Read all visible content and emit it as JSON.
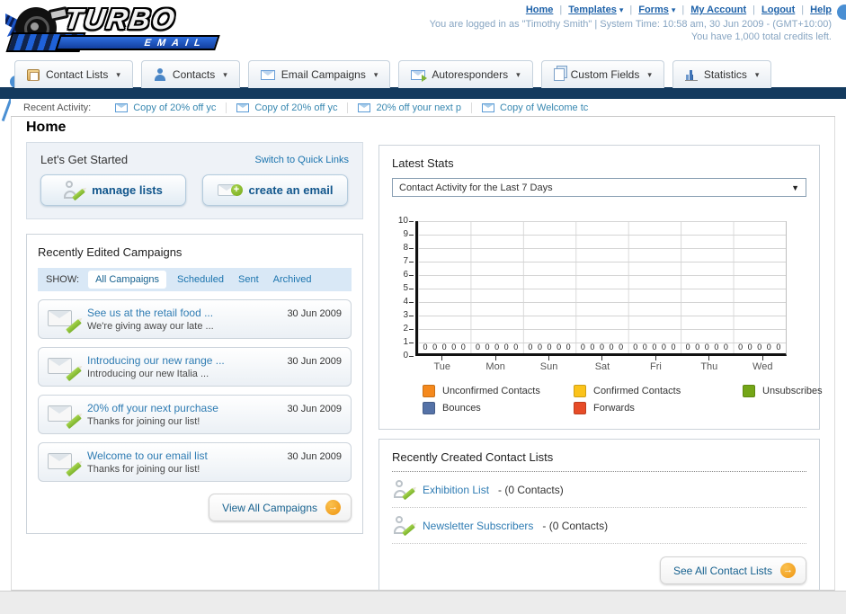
{
  "header": {
    "logo_line1": "TURBO",
    "logo_line2": "EMAIL",
    "nav_links": [
      {
        "label": "Home",
        "dropdown": false
      },
      {
        "label": "Templates",
        "dropdown": true
      },
      {
        "label": "Forms",
        "dropdown": true
      },
      {
        "label": "My Account",
        "dropdown": false
      },
      {
        "label": "Logout",
        "dropdown": false
      },
      {
        "label": "Help",
        "dropdown": false
      }
    ],
    "login_info": "You are logged in as \"Timothy Smith\" | System Time: 10:58 am, 30 Jun 2009 - (GMT+10:00)",
    "credits_info": "You have 1,000 total credits left."
  },
  "main_nav": {
    "tabs": [
      {
        "label": "Contact Lists",
        "icon": "address-book-icon"
      },
      {
        "label": "Contacts",
        "icon": "person-icon"
      },
      {
        "label": "Email Campaigns",
        "icon": "envelope-icon"
      },
      {
        "label": "Autoresponders",
        "icon": "envelope-arrow-icon"
      },
      {
        "label": "Custom Fields",
        "icon": "pages-icon"
      },
      {
        "label": "Statistics",
        "icon": "bar-chart-icon"
      }
    ]
  },
  "recent_activity": {
    "label": "Recent Activity:",
    "items": [
      "Copy of 20% off yc",
      "Copy of 20% off yc",
      "20% off your next p",
      "Copy of Welcome tc"
    ]
  },
  "page_title": "Home",
  "get_started": {
    "title": "Let's Get Started",
    "switch_link": "Switch to Quick Links",
    "buttons": [
      {
        "label": "manage lists",
        "icon": "person-edit-icon"
      },
      {
        "label": "create an email",
        "icon": "envelope-plus-icon"
      }
    ]
  },
  "campaigns": {
    "title": "Recently Edited Campaigns",
    "show_label": "SHOW:",
    "tabs": [
      "All Campaigns",
      "Scheduled",
      "Sent",
      "Archived"
    ],
    "active_tab": "All Campaigns",
    "items": [
      {
        "title": "See us at the retail food ...",
        "subtitle": "We're giving away our late ...",
        "date": "30 Jun 2009"
      },
      {
        "title": "Introducing our new range ...",
        "subtitle": "Introducing our new Italia ...",
        "date": "30 Jun 2009"
      },
      {
        "title": "20% off your next purchase",
        "subtitle": "Thanks for joining our list!",
        "date": "30 Jun 2009"
      },
      {
        "title": "Welcome to our email list",
        "subtitle": "Thanks for joining our list!",
        "date": "30 Jun 2009"
      }
    ],
    "view_all_label": "View All Campaigns",
    "arrow_glyph": "→"
  },
  "latest_stats": {
    "title": "Latest Stats",
    "dropdown_value": "Contact Activity for the Last 7 Days"
  },
  "chart_data": {
    "type": "bar",
    "title": "Contact Activity for the Last 7 Days",
    "categories": [
      "Tue",
      "Mon",
      "Sun",
      "Sat",
      "Fri",
      "Thu",
      "Wed"
    ],
    "series": [
      {
        "name": "Unconfirmed Contacts",
        "color": "#F5891D",
        "values": [
          0,
          0,
          0,
          0,
          0,
          0,
          0
        ]
      },
      {
        "name": "Confirmed Contacts",
        "color": "#FBC31B",
        "values": [
          0,
          0,
          0,
          0,
          0,
          0,
          0
        ]
      },
      {
        "name": "Unsubscribes",
        "color": "#74A617",
        "values": [
          0,
          0,
          0,
          0,
          0,
          0,
          0
        ]
      },
      {
        "name": "Bounces",
        "color": "#5572A7",
        "values": [
          0,
          0,
          0,
          0,
          0,
          0,
          0
        ]
      },
      {
        "name": "Forwards",
        "color": "#E74C28",
        "values": [
          0,
          0,
          0,
          0,
          0,
          0,
          0
        ]
      }
    ],
    "ylim": [
      0,
      10
    ],
    "yticks": [
      0,
      1,
      2,
      3,
      4,
      5,
      6,
      7,
      8,
      9,
      10
    ],
    "grid": true,
    "legend_position": "bottom",
    "xlabel": "",
    "ylabel": ""
  },
  "contact_lists": {
    "title": "Recently Created Contact Lists",
    "items": [
      {
        "name": "Exhibition List",
        "detail": "- (0 Contacts)"
      },
      {
        "name": "Newsletter Subscribers",
        "detail": "- (0 Contacts)"
      }
    ],
    "see_all_label": "See All Contact Lists",
    "arrow_glyph": "→"
  }
}
